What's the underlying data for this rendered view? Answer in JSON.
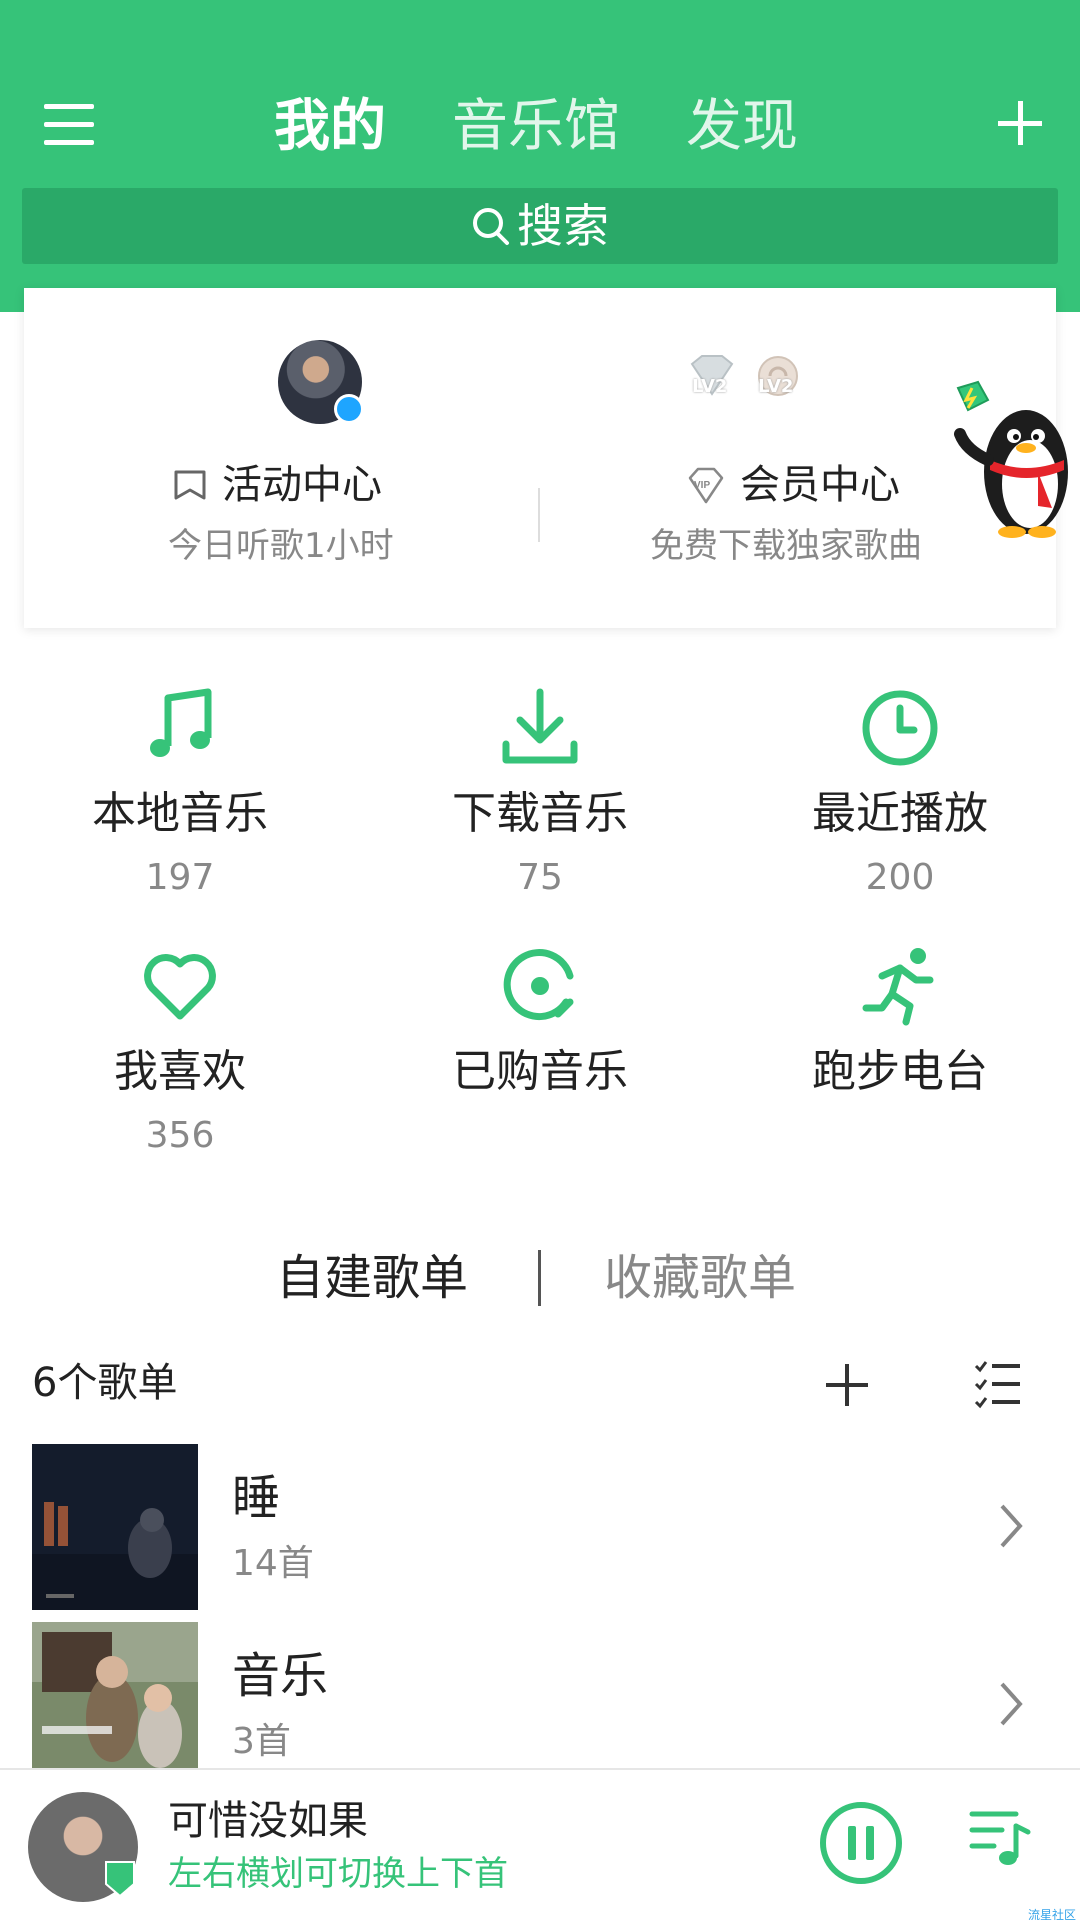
{
  "header": {
    "tabs": [
      {
        "label": "我的",
        "active": true
      },
      {
        "label": "音乐馆",
        "active": false
      },
      {
        "label": "发现",
        "active": false
      }
    ],
    "menu_icon": "hamburger-icon",
    "add_icon": "plus-icon",
    "search_placeholder": "搜索",
    "accent_color": "#36c379"
  },
  "profile": {
    "level_badges": [
      "LV2",
      "LV2"
    ],
    "activity": {
      "title": "活动中心",
      "subtitle": "今日听歌1小时",
      "icon": "flag-icon"
    },
    "vip": {
      "title": "会员中心",
      "subtitle": "免费下载独家歌曲",
      "icon": "vip-diamond-icon"
    }
  },
  "grid": [
    {
      "label": "本地音乐",
      "count": "197",
      "icon": "music-note-icon"
    },
    {
      "label": "下载音乐",
      "count": "75",
      "icon": "download-icon"
    },
    {
      "label": "最近播放",
      "count": "200",
      "icon": "clock-icon"
    },
    {
      "label": "我喜欢",
      "count": "356",
      "icon": "heart-icon"
    },
    {
      "label": "已购音乐",
      "count": "",
      "icon": "purchased-disc-icon"
    },
    {
      "label": "跑步电台",
      "count": "",
      "icon": "running-icon"
    }
  ],
  "playlist_tabs": [
    {
      "label": "自建歌单",
      "active": true
    },
    {
      "label": "收藏歌单",
      "active": false
    }
  ],
  "playlist_summary": "6个歌单",
  "playlists": [
    {
      "name": "睡",
      "count": "14首"
    },
    {
      "name": "音乐",
      "count": "3首"
    }
  ],
  "player": {
    "song_title": "可惜没如果",
    "hint": "左右横划可切换上下首",
    "state": "playing"
  },
  "watermark": "流星社区"
}
